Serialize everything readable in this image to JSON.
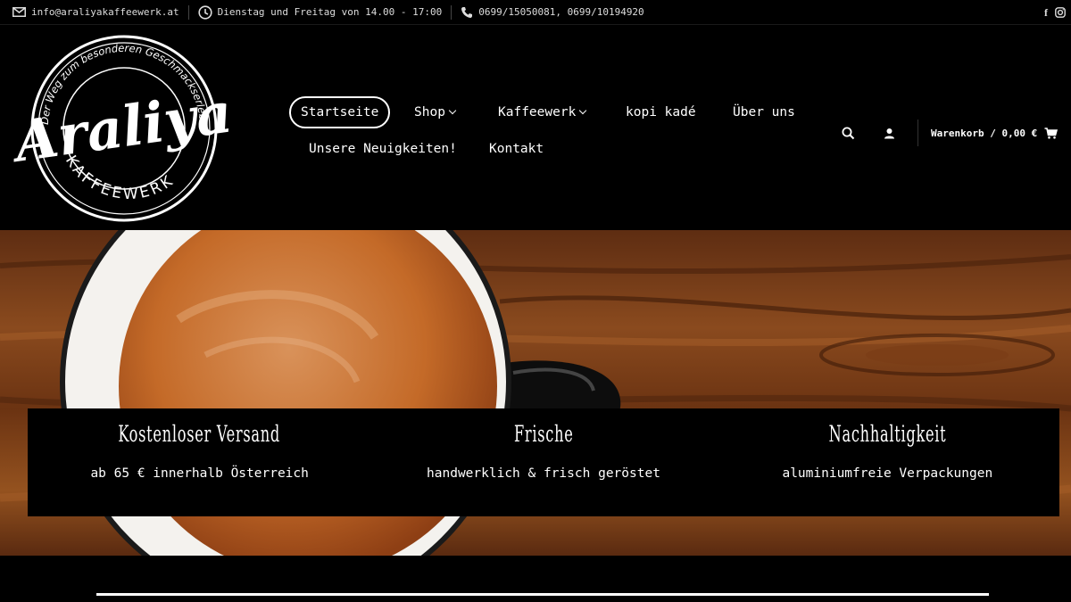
{
  "topbar": {
    "email": "info@araliyakaffeewerk.at",
    "hours": "Dienstag und Freitag von 14.00 - 17:00",
    "phone": "0699/15050081, 0699/10194920",
    "social": [
      "facebook-icon",
      "instagram-icon"
    ]
  },
  "logo": {
    "arc_text": "Der Weg zum besonderen Geschmackserlebnis",
    "name": "Araliya",
    "sub": "KAFFEEWERK"
  },
  "nav": {
    "items": [
      {
        "label": "Startseite",
        "active": true
      },
      {
        "label": "Shop",
        "dropdown": true
      },
      {
        "label": "Kaffeewerk",
        "dropdown": true
      },
      {
        "label": "kopi kadé"
      },
      {
        "label": "Über uns"
      },
      {
        "label": "Unsere Neuigkeiten!"
      },
      {
        "label": "Kontakt"
      }
    ]
  },
  "cart": {
    "label": "Warenkorb / 0,00 €"
  },
  "features": [
    {
      "title": "Kostenloser Versand",
      "subtitle": "ab 65 € innerhalb Österreich"
    },
    {
      "title": "Frische",
      "subtitle": "handwerklich & frisch geröstet"
    },
    {
      "title": "Nachhaltigkeit",
      "subtitle": "aluminiumfreie Verpackungen"
    }
  ],
  "hero": {
    "cup_print": "Der Weg zum besonderen Geschmackserlebnis"
  },
  "colors": {
    "background": "#000000",
    "text": "#ffffff",
    "wood": "#7a3a16",
    "crema": "#c8702a"
  }
}
